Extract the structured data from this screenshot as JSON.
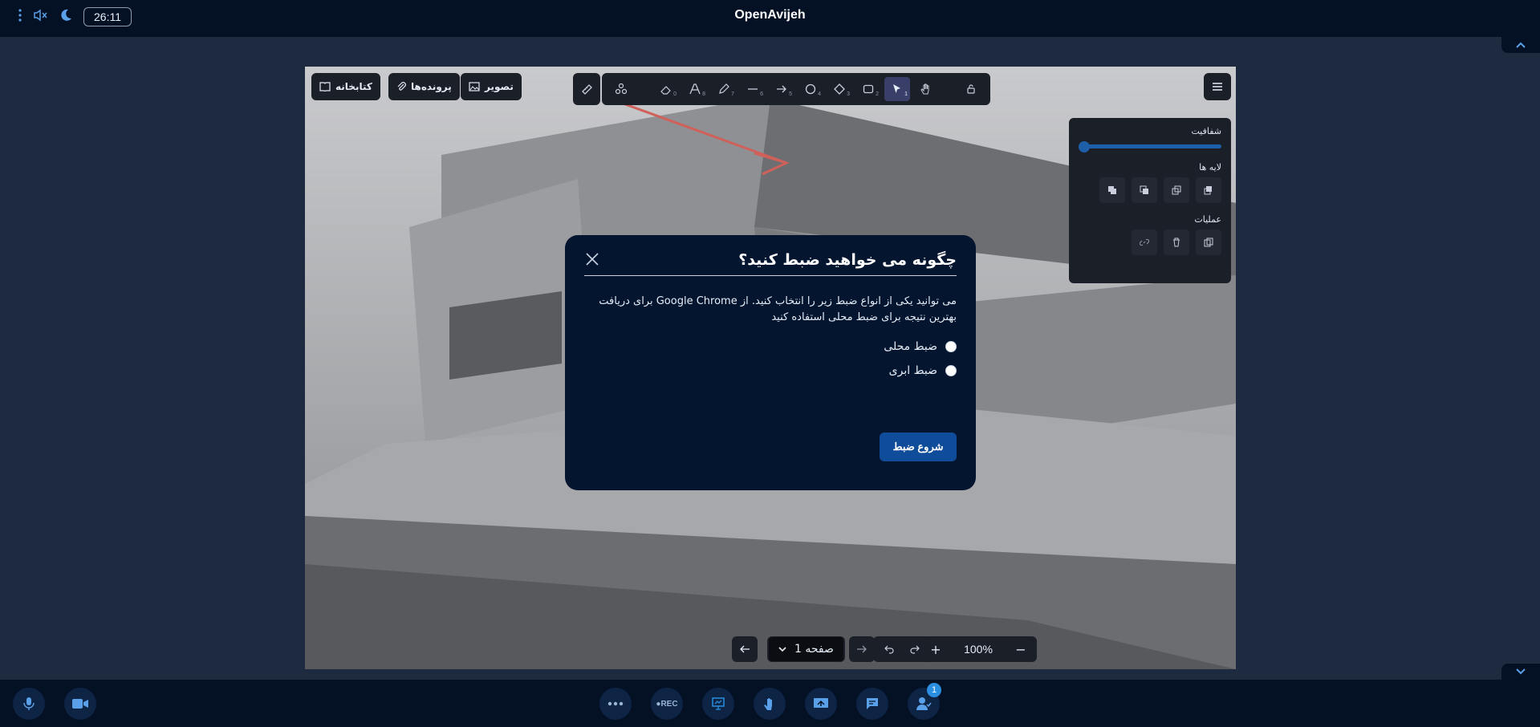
{
  "app": {
    "title": "OpenAvijeh",
    "timer": "26:11"
  },
  "board": {
    "pills": {
      "library": "کتابخانه",
      "files": "پرونده‌ها",
      "image": "تصویر"
    },
    "tools": [
      {
        "name": "lock",
        "num": ""
      },
      {
        "name": "hand",
        "num": ""
      },
      {
        "name": "select",
        "num": "1"
      },
      {
        "name": "rectangle",
        "num": "2"
      },
      {
        "name": "diamond",
        "num": "3"
      },
      {
        "name": "ellipse",
        "num": "4"
      },
      {
        "name": "arrow",
        "num": "5"
      },
      {
        "name": "line",
        "num": "6"
      },
      {
        "name": "pencil",
        "num": "7"
      },
      {
        "name": "text",
        "num": "8"
      },
      {
        "name": "eraser",
        "num": "0"
      },
      {
        "name": "shapes",
        "num": ""
      }
    ],
    "props": {
      "opacity_label": "شفافیت",
      "opacity_value": 0,
      "layers_label": "لایه ها",
      "actions_label": "عملیات"
    },
    "nav": {
      "page_label": "صفحه 1",
      "zoom": "100%"
    }
  },
  "modal": {
    "title": "چگونه می خواهید ضبط کنید؟",
    "description": "می توانید یکی از انواع ضبط زیر را انتخاب کنید. از Google Chrome برای دریافت بهترین نتیجه برای ضبط محلی استفاده کنید",
    "options": [
      "ضبط محلی",
      "ضبط ابری"
    ],
    "start_button": "شروع ضبط"
  },
  "bottombar": {
    "rec_label": "●REC",
    "participants_badge": "1"
  },
  "colors": {
    "accent": "#1d5fa8",
    "topbar": "#041024",
    "modal": "#041530",
    "button": "#0f4c9a"
  }
}
